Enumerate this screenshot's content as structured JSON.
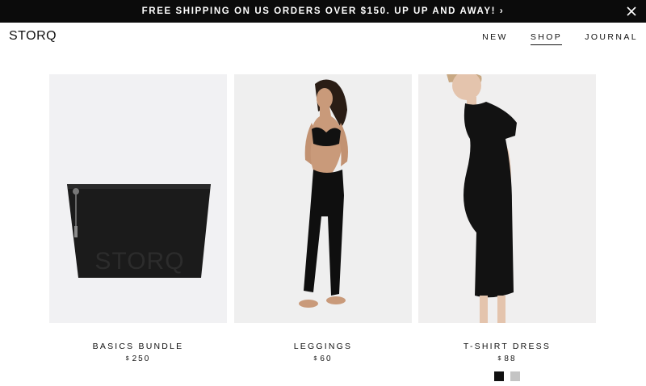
{
  "promo": {
    "text": "FREE SHIPPING ON US ORDERS OVER $150. UP UP AND AWAY! ›"
  },
  "header": {
    "logo": "STORQ",
    "nav": [
      {
        "label": "NEW"
      },
      {
        "label": "SHOP",
        "active": true
      },
      {
        "label": "JOURNAL"
      }
    ]
  },
  "products": [
    {
      "name": "BASICS BUNDLE",
      "currency": "$",
      "price": "250",
      "image_bg": "#f1f1f3",
      "bag_text": "STORQ"
    },
    {
      "name": "LEGGINGS",
      "currency": "$",
      "price": "60",
      "image_bg": "#efefef"
    },
    {
      "name": "T-SHIRT DRESS",
      "currency": "$",
      "price": "88",
      "image_bg": "#f0efef",
      "swatches": [
        "#111111",
        "#c4c4c4"
      ]
    }
  ]
}
